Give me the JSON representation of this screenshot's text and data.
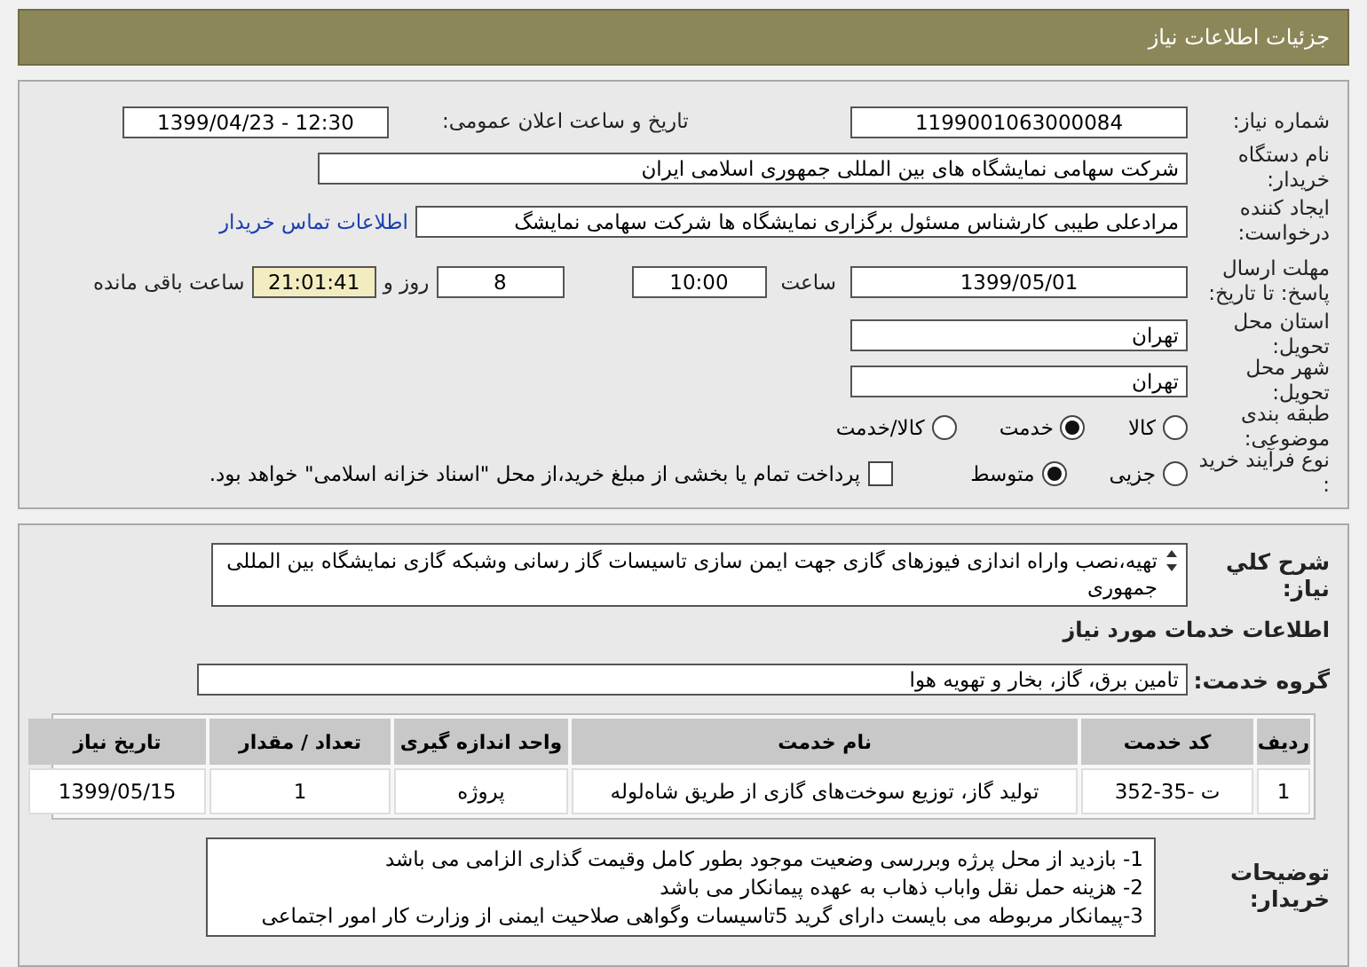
{
  "header": {
    "title": "جزئیات اطلاعات نیاز"
  },
  "need_number": {
    "label": "شماره نیاز:",
    "value": "1199001063000084"
  },
  "announce": {
    "label": "تاریخ و ساعت اعلان عمومی:",
    "value": "1399/04/23 - 12:30"
  },
  "buyer": {
    "label": "نام دستگاه خریدار:",
    "value": "شرکت سهامی نمایشگاه های بین المللی جمهوری اسلامی ایران"
  },
  "requester": {
    "label": "ایجاد کننده درخواست:",
    "value": "مرادعلی طیبی کارشناس مسئول برگزاری نمایشگاه ها شرکت سهامی نمایشگ",
    "contact_link": "اطلاعات تماس خریدار"
  },
  "deadline": {
    "label": "مهلت ارسال پاسخ: تا تاریخ:",
    "date": "1399/05/01",
    "time_label": "ساعت",
    "time": "10:00",
    "days": "8",
    "days_label": "روز و",
    "remaining": "21:01:41",
    "remaining_label": "ساعت باقی مانده"
  },
  "province": {
    "label": "استان محل تحویل:",
    "value": "تهران"
  },
  "city": {
    "label": "شهر محل تحویل:",
    "value": "تهران"
  },
  "category": {
    "label": "طبقه بندی موضوعی:",
    "options": [
      {
        "label": "کالا",
        "selected": false
      },
      {
        "label": "خدمت",
        "selected": true
      },
      {
        "label": "کالا/خدمت",
        "selected": false
      }
    ]
  },
  "purchase_process": {
    "label": "نوع فرآیند خرید :",
    "options": [
      {
        "label": "جزیی",
        "selected": false
      },
      {
        "label": "متوسط",
        "selected": true
      }
    ],
    "treasury": {
      "label": "پرداخت تمام یا بخشی از مبلغ خرید،از محل \"اسناد خزانه اسلامی\" خواهد بود.",
      "checked": false
    }
  },
  "description": {
    "label": "شرح کلي نياز:",
    "value": "تهیه،نصب واراه اندازی فیوزهای گازی جهت ایمن سازی تاسیسات گاز رسانی وشبکه گازی نمایشگاه بین المللی جمهوری"
  },
  "services_heading": "اطلاعات خدمات مورد نیاز",
  "service_group": {
    "label": "گروه خدمت:",
    "value": "تامین برق، گاز، بخار و تهویه هوا"
  },
  "table": {
    "columns": [
      "ردیف",
      "کد خدمت",
      "نام خدمت",
      "واحد اندازه گیری",
      "تعداد / مقدار",
      "تاریخ نیاز"
    ],
    "rows": [
      [
        "1",
        "ت -35-352",
        "تولید گاز، توزیع سوخت‌های گازی از طریق شاه‌لوله",
        "پروژه",
        "1",
        "1399/05/15"
      ]
    ]
  },
  "buyer_notes": {
    "label": "توضیحات خریدار:",
    "lines": [
      "1- بازدید از محل پرژه وبررسی وضعیت موجود بطور کامل وقیمت گذاری الزامی می باشد",
      "2- هزینه حمل نقل واباب ذهاب به عهده پیمانکار می باشد",
      "3-پیمانکار  مربوطه می بایست دارای گرید 5تاسیسات وگواهی صلاحیت ایمنی از وزارت کار امور اجتماعی"
    ]
  }
}
